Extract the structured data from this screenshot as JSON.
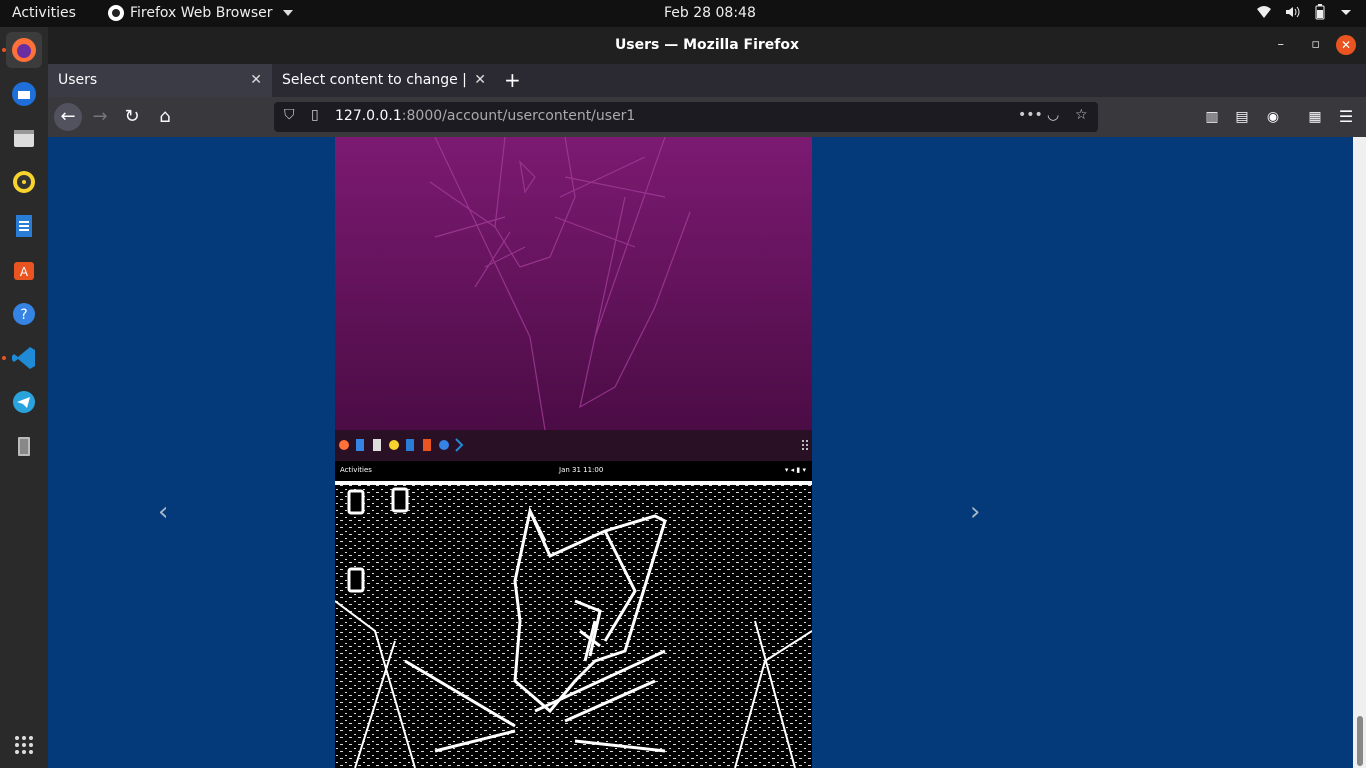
{
  "system": {
    "activities": "Activities",
    "app_menu": "Firefox Web Browser",
    "clock": "Feb 28  08:48"
  },
  "dock": {
    "items": [
      "firefox",
      "thunderbird",
      "files",
      "rhythmbox",
      "writer",
      "software",
      "help",
      "vscode",
      "telegram",
      "trash"
    ],
    "apps_grid": "show-applications"
  },
  "window": {
    "title": "Users — Mozilla Firefox",
    "controls": {
      "minimize": "–",
      "maximize": "▫",
      "close": "✕"
    }
  },
  "tabs": [
    {
      "label": "Users",
      "active": true
    },
    {
      "label": "Select content to change | D",
      "active": false
    }
  ],
  "urlbar": {
    "host": "127.0.0.1",
    "path": ":8000/account/usercontent/user1"
  },
  "carousel": {
    "prev": "‹",
    "next": "›",
    "inner_topbar_left": "Activities",
    "inner_topbar_clock": "Jan 31  11:00",
    "desktop_icons": [
      "trash",
      "home",
      "folder"
    ]
  },
  "colors": {
    "page_bg": "#053a7a",
    "accent": "#e95420",
    "purple_top": "#7c1a72",
    "purple_bottom": "#4b0c45"
  }
}
